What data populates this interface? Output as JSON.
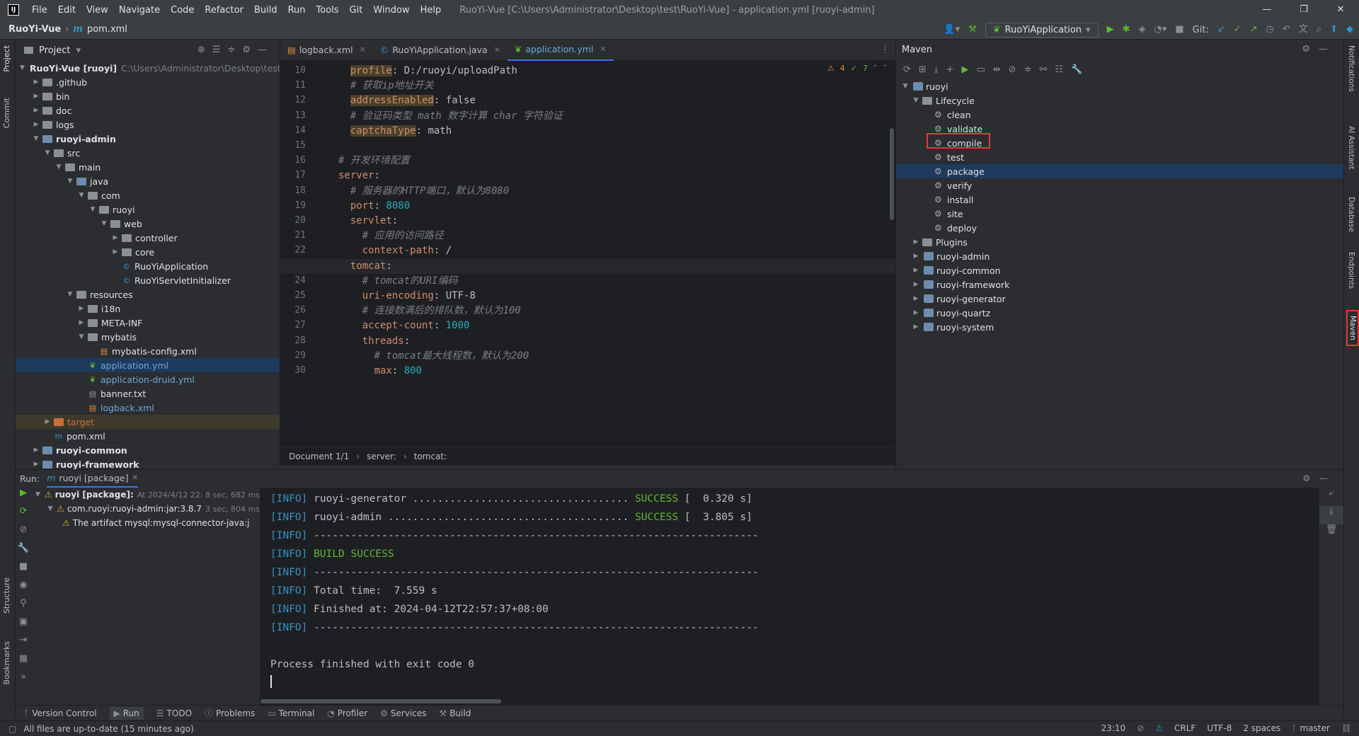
{
  "window": {
    "title": "RuoYi-Vue [C:\\Users\\Administrator\\Desktop\\test\\RuoYi-Vue] - application.yml [ruoyi-admin]",
    "menu": [
      "File",
      "Edit",
      "View",
      "Navigate",
      "Code",
      "Refactor",
      "Build",
      "Run",
      "Tools",
      "Git",
      "Window",
      "Help"
    ],
    "logo": "IJ",
    "controls": [
      "—",
      "❐",
      "✕"
    ]
  },
  "nav": {
    "project": "RuoYi-Vue",
    "file": "pom.xml",
    "run_config": "RuoYiApplication",
    "git_label": "Git:"
  },
  "left_strip": {
    "project": "Project",
    "commit": "Commit",
    "structure": "Structure",
    "bookmarks": "Bookmarks"
  },
  "project": {
    "title": "Project",
    "items": [
      {
        "label": "RuoYi-Vue [ruoyi]",
        "path": "C:\\Users\\Administrator\\Desktop\\test\\",
        "indent": 0,
        "arrow": "open",
        "type": "module",
        "bold": true
      },
      {
        "label": ".github",
        "indent": 1,
        "arrow": "closed",
        "type": "folder"
      },
      {
        "label": "bin",
        "indent": 1,
        "arrow": "closed",
        "type": "folder"
      },
      {
        "label": "doc",
        "indent": 1,
        "arrow": "closed",
        "type": "folder"
      },
      {
        "label": "logs",
        "indent": 1,
        "arrow": "closed",
        "type": "folder"
      },
      {
        "label": "ruoyi-admin",
        "indent": 1,
        "arrow": "open",
        "type": "module",
        "bold": true
      },
      {
        "label": "src",
        "indent": 2,
        "arrow": "open",
        "type": "folder"
      },
      {
        "label": "main",
        "indent": 3,
        "arrow": "open",
        "type": "folder"
      },
      {
        "label": "java",
        "indent": 4,
        "arrow": "open",
        "type": "srcfolder"
      },
      {
        "label": "com",
        "indent": 5,
        "arrow": "open",
        "type": "folder"
      },
      {
        "label": "ruoyi",
        "indent": 6,
        "arrow": "open",
        "type": "folder"
      },
      {
        "label": "web",
        "indent": 7,
        "arrow": "open",
        "type": "folder"
      },
      {
        "label": "controller",
        "indent": 8,
        "arrow": "closed",
        "type": "folder"
      },
      {
        "label": "core",
        "indent": 8,
        "arrow": "closed",
        "type": "folder"
      },
      {
        "label": "RuoYiApplication",
        "indent": 8,
        "arrow": "none",
        "type": "class"
      },
      {
        "label": "RuoYiServletInitializer",
        "indent": 8,
        "arrow": "none",
        "type": "class"
      },
      {
        "label": "resources",
        "indent": 4,
        "arrow": "open",
        "type": "resfolder"
      },
      {
        "label": "i18n",
        "indent": 5,
        "arrow": "closed",
        "type": "folder"
      },
      {
        "label": "META-INF",
        "indent": 5,
        "arrow": "closed",
        "type": "folder"
      },
      {
        "label": "mybatis",
        "indent": 5,
        "arrow": "open",
        "type": "folder"
      },
      {
        "label": "mybatis-config.xml",
        "indent": 6,
        "arrow": "none",
        "type": "xml"
      },
      {
        "label": "application.yml",
        "indent": 5,
        "arrow": "none",
        "type": "yml",
        "selected": true
      },
      {
        "label": "application-druid.yml",
        "indent": 5,
        "arrow": "none",
        "type": "yml"
      },
      {
        "label": "banner.txt",
        "indent": 5,
        "arrow": "none",
        "type": "txt"
      },
      {
        "label": "logback.xml",
        "indent": 5,
        "arrow": "none",
        "type": "xml"
      },
      {
        "label": "target",
        "indent": 2,
        "arrow": "closed",
        "type": "excluded",
        "highlight": true
      },
      {
        "label": "pom.xml",
        "indent": 2,
        "arrow": "none",
        "type": "maven"
      },
      {
        "label": "ruoyi-common",
        "indent": 1,
        "arrow": "closed",
        "type": "module",
        "bold": true
      },
      {
        "label": "ruoyi-framework",
        "indent": 1,
        "arrow": "closed",
        "type": "module",
        "bold": true
      }
    ]
  },
  "editor": {
    "tabs": [
      {
        "label": "logback.xml",
        "active": false
      },
      {
        "label": "RuoYiApplication.java",
        "active": false
      },
      {
        "label": "application.yml",
        "active": true
      }
    ],
    "inspections": {
      "warnings": "4",
      "ok": "7"
    },
    "breadcrumbs": [
      "Document 1/1",
      "server:",
      "tomcat:"
    ],
    "lines": [
      {
        "n": "10",
        "indent": "  ",
        "key": "profile",
        "key_hl": true,
        "value": " D:/ruoyi/uploadPath",
        "comment": ""
      },
      {
        "n": "11",
        "indent": "  ",
        "key": "",
        "comment": "# 获取ip地址开关"
      },
      {
        "n": "12",
        "indent": "  ",
        "key": "addressEnabled",
        "key_hl": true,
        "value": " false",
        "comment": ""
      },
      {
        "n": "13",
        "indent": "  ",
        "key": "",
        "comment": "# 验证码类型 math 数字计算 char 字符验证"
      },
      {
        "n": "14",
        "indent": "  ",
        "key": "captchaType",
        "key_hl": true,
        "value": " math",
        "comment": ""
      },
      {
        "n": "15",
        "indent": "",
        "key": "",
        "comment": ""
      },
      {
        "n": "16",
        "indent": "",
        "key": "",
        "comment": "# 开发环境配置"
      },
      {
        "n": "17",
        "indent": "",
        "key": "server",
        "value": "",
        "comment": ""
      },
      {
        "n": "18",
        "indent": "  ",
        "key": "",
        "comment": "# 服务器的HTTP端口，默认为8080"
      },
      {
        "n": "19",
        "indent": "  ",
        "key": "port",
        "value": " 8080",
        "comment": "",
        "numval": true
      },
      {
        "n": "20",
        "indent": "  ",
        "key": "servlet",
        "value": "",
        "comment": ""
      },
      {
        "n": "21",
        "indent": "    ",
        "key": "",
        "comment": "# 应用的访问路径"
      },
      {
        "n": "22",
        "indent": "    ",
        "key": "context-path",
        "value": " /",
        "comment": ""
      },
      {
        "n": "23",
        "indent": "  ",
        "key": "tomcat",
        "value": "",
        "comment": "",
        "current": true
      },
      {
        "n": "24",
        "indent": "    ",
        "key": "",
        "comment": "# tomcat的URI编码"
      },
      {
        "n": "25",
        "indent": "    ",
        "key": "uri-encoding",
        "value": " UTF-8",
        "comment": ""
      },
      {
        "n": "26",
        "indent": "    ",
        "key": "",
        "comment": "# 连接数满后的排队数，默认为100"
      },
      {
        "n": "27",
        "indent": "    ",
        "key": "accept-count",
        "value": " 1000",
        "comment": "",
        "numval": true
      },
      {
        "n": "28",
        "indent": "    ",
        "key": "threads",
        "value": "",
        "comment": ""
      },
      {
        "n": "29",
        "indent": "      ",
        "key": "",
        "comment": "# tomcat最大线程数，默认为200"
      },
      {
        "n": "30",
        "indent": "      ",
        "key": "max",
        "value": " 800",
        "comment": "",
        "numval": true
      }
    ]
  },
  "maven": {
    "title": "Maven",
    "items": [
      {
        "label": "ruoyi",
        "indent": 0,
        "arrow": "open",
        "type": "module"
      },
      {
        "label": "Lifecycle",
        "indent": 1,
        "arrow": "open",
        "type": "folder"
      },
      {
        "label": "clean",
        "indent": 2,
        "type": "goal"
      },
      {
        "label": "validate",
        "indent": 2,
        "type": "goal"
      },
      {
        "label": "compile",
        "indent": 2,
        "type": "goal"
      },
      {
        "label": "test",
        "indent": 2,
        "type": "goal"
      },
      {
        "label": "package",
        "indent": 2,
        "type": "goal",
        "selected": true
      },
      {
        "label": "verify",
        "indent": 2,
        "type": "goal"
      },
      {
        "label": "install",
        "indent": 2,
        "type": "goal"
      },
      {
        "label": "site",
        "indent": 2,
        "type": "goal"
      },
      {
        "label": "deploy",
        "indent": 2,
        "type": "goal"
      },
      {
        "label": "Plugins",
        "indent": 1,
        "arrow": "closed",
        "type": "folder"
      },
      {
        "label": "ruoyi-admin",
        "indent": 1,
        "arrow": "closed",
        "type": "module"
      },
      {
        "label": "ruoyi-common",
        "indent": 1,
        "arrow": "closed",
        "type": "module"
      },
      {
        "label": "ruoyi-framework",
        "indent": 1,
        "arrow": "closed",
        "type": "module"
      },
      {
        "label": "ruoyi-generator",
        "indent": 1,
        "arrow": "closed",
        "type": "module"
      },
      {
        "label": "ruoyi-quartz",
        "indent": 1,
        "arrow": "closed",
        "type": "module"
      },
      {
        "label": "ruoyi-system",
        "indent": 1,
        "arrow": "closed",
        "type": "module"
      }
    ]
  },
  "right_strip": {
    "notifications": "Notifications",
    "ai": "AI Assistant",
    "database": "Database",
    "endpoints": "Endpoints",
    "maven": "Maven"
  },
  "run": {
    "label": "Run:",
    "tab": "ruoyi [package]",
    "tree": [
      {
        "label": "ruoyi [package]:",
        "time": "At 2024/4/12 22: 8 sec, 682 ms",
        "indent": 0
      },
      {
        "label": "com.ruoyi:ruoyi-admin:jar:3.8.7",
        "time": "3 sec, 804 ms",
        "indent": 1
      },
      {
        "label": "The artifact mysql:mysql-connector-java:j",
        "time": "",
        "indent": 2
      }
    ],
    "console": [
      {
        "tag": "[INFO]",
        "text": " ruoyi-generator ................................... ",
        "status": "SUCCESS",
        "tail": " [  0.320 s]"
      },
      {
        "tag": "[INFO]",
        "text": " ruoyi-admin ....................................... ",
        "status": "SUCCESS",
        "tail": " [  3.805 s]"
      },
      {
        "tag": "[INFO]",
        "text": " ------------------------------------------------------------------------",
        "status": "",
        "tail": ""
      },
      {
        "tag": "[INFO]",
        "text": " ",
        "status": "BUILD SUCCESS",
        "tail": ""
      },
      {
        "tag": "[INFO]",
        "text": " ------------------------------------------------------------------------",
        "status": "",
        "tail": ""
      },
      {
        "tag": "[INFO]",
        "text": " Total time:  7.559 s",
        "status": "",
        "tail": ""
      },
      {
        "tag": "[INFO]",
        "text": " Finished at: 2024-04-12T22:57:37+08:00",
        "status": "",
        "tail": ""
      },
      {
        "tag": "[INFO]",
        "text": " ------------------------------------------------------------------------",
        "status": "",
        "tail": ""
      },
      {
        "tag": "",
        "text": "",
        "status": "",
        "tail": ""
      },
      {
        "tag": "",
        "text": "Process finished with exit code 0",
        "status": "",
        "tail": ""
      }
    ]
  },
  "bottom_tabs": [
    "Version Control",
    "Run",
    "TODO",
    "Problems",
    "Terminal",
    "Profiler",
    "Services",
    "Build"
  ],
  "status": {
    "message": "All files are up-to-date (15 minutes ago)",
    "position": "23:10",
    "line_sep": "CRLF",
    "encoding": "UTF-8",
    "indent": "2 spaces",
    "branch": "master"
  }
}
